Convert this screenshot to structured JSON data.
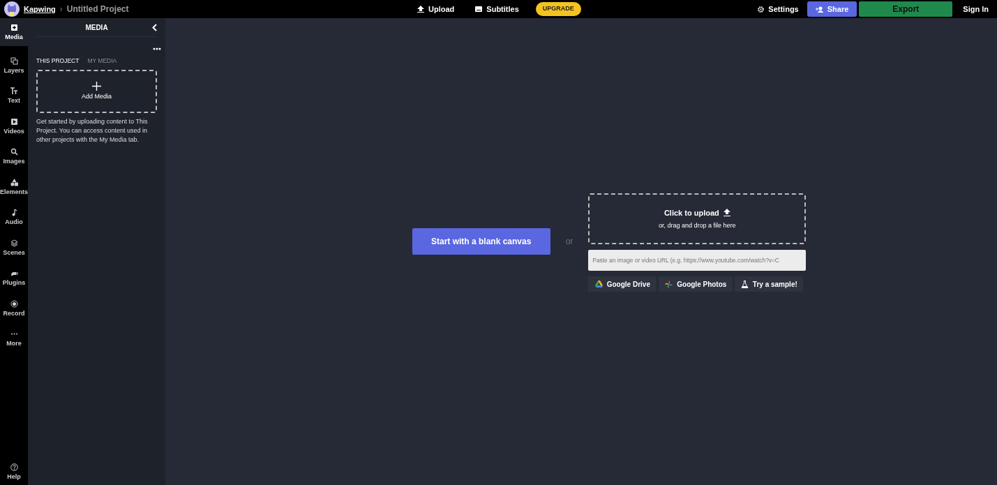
{
  "header": {
    "brand": "Kapwing",
    "separator": "›",
    "project": "Untitled Project",
    "upload": "Upload",
    "subtitles": "Subtitles",
    "upgrade": "UPGRADE",
    "settings": "Settings",
    "share": "Share",
    "export": "Export",
    "sign_in": "Sign In"
  },
  "rail": [
    {
      "label": "Media",
      "selected": true
    },
    {
      "label": "Layers",
      "selected": false
    },
    {
      "label": "Text",
      "selected": false
    },
    {
      "label": "Videos",
      "selected": false
    },
    {
      "label": "Images",
      "selected": false
    },
    {
      "label": "Elements",
      "selected": false
    },
    {
      "label": "Audio",
      "selected": false
    },
    {
      "label": "Scenes",
      "selected": false
    },
    {
      "label": "Plugins",
      "selected": false
    },
    {
      "label": "Record",
      "selected": false
    },
    {
      "label": "More",
      "selected": false
    }
  ],
  "help": "Help",
  "panel": {
    "title": "MEDIA",
    "tabs": [
      {
        "label": "THIS PROJECT",
        "selected": true
      },
      {
        "label": "MY MEDIA",
        "selected": false
      }
    ],
    "add_media": "Add Media",
    "info": "Get started by uploading content to This Project. You can access content used in other projects with the My Media tab."
  },
  "main": {
    "blank_canvas": "Start with a blank canvas",
    "or": "or",
    "upload_title": "Click to upload",
    "upload_sub": "or, drag and drop a file here",
    "url_placeholder": "Paste an image or video URL (e.g. https://www.youtube.com/watch?v=C",
    "sources": [
      "Google Drive",
      "Google Photos",
      "Try a sample!"
    ]
  }
}
